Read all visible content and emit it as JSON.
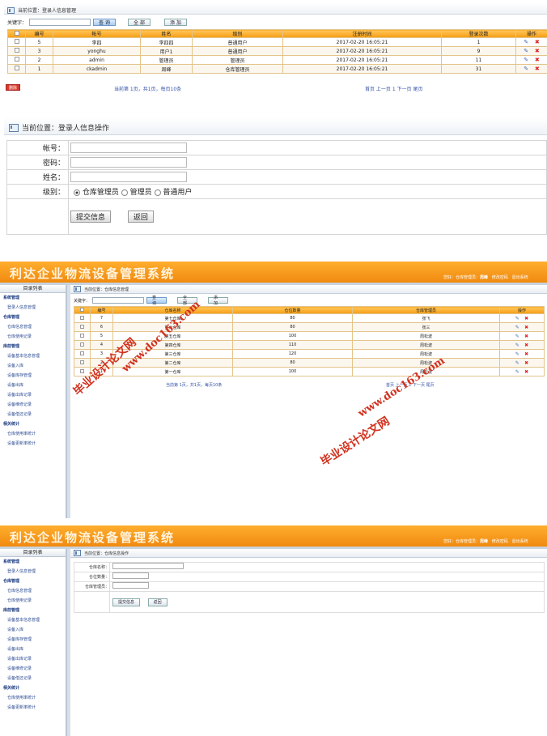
{
  "s1": {
    "crumb": "当前位置：登录人信息管理",
    "kw_label": "关键字：",
    "search_btn": "查 询",
    "all_btn": "全 部",
    "add_btn": "添 加",
    "cols": [
      "编号",
      "帐号",
      "姓名",
      "级别",
      "注册时间",
      "登录次数",
      "操作"
    ],
    "rows": [
      [
        "5",
        "李四",
        "李四四",
        "普通用户",
        "2017-02-20 16:05:21",
        "1"
      ],
      [
        "3",
        "yonghu",
        "用户1",
        "普通用户",
        "2017-02-20 16:05:21",
        "9"
      ],
      [
        "2",
        "admin",
        "管理员",
        "管理员",
        "2017-02-20 16:05:21",
        "11"
      ],
      [
        "1",
        "ckadmin",
        "周峰",
        "仓库管理员",
        "2017-02-20 16:05:21",
        "31"
      ]
    ],
    "delete_btn": "删除",
    "pager_info": "当前第 1页，共1页，每页10条",
    "pager_nav": "首页 上一页 1 下一页 尾页"
  },
  "s2": {
    "crumb": "当前位置：登录人信息操作",
    "labels": [
      "帐号：",
      "密码：",
      "姓名：",
      "级别："
    ],
    "radios": [
      "仓库管理员",
      "管理员",
      "普通用户"
    ],
    "submit": "提交信息",
    "back": "返回"
  },
  "app": {
    "title": "利达企业物流设备管理系统",
    "user_info": "您好：仓库管理员：",
    "user_name": "周峰",
    "change_pwd": "修改密码",
    "logout": "退出系统",
    "menu_title": "目录列表",
    "menu": [
      {
        "group": "系统管理",
        "items": [
          "登录人信息管理"
        ]
      },
      {
        "group": "仓库管理",
        "items": [
          "仓库信息管理",
          "仓库使用记录"
        ]
      },
      {
        "group": "库前管理",
        "items": [
          "设备基本信息管理",
          "设备入库",
          "设备库存管理",
          "设备出库",
          "设备出库记录",
          "设备维修记录",
          "设备借还记录"
        ]
      },
      {
        "group": "相关统计",
        "items": [
          "仓库使用率统计",
          "设备更新率统计"
        ]
      }
    ]
  },
  "s3": {
    "crumb": "当前位置：仓库信息管理",
    "kw_label": "关键字：",
    "search_btn": "查 询",
    "all_btn": "全 部",
    "add_btn": "添 加",
    "cols": [
      "编号",
      "仓库名称",
      "仓位数量",
      "仓库管理员",
      "操作"
    ],
    "rows": [
      [
        "7",
        "第七仓库",
        "80",
        "张飞"
      ],
      [
        "6",
        "第六仓库",
        "80",
        "张三"
      ],
      [
        "5",
        "第五仓库",
        "100",
        "周松波"
      ],
      [
        "4",
        "第四仓库",
        "110",
        "周松波"
      ],
      [
        "3",
        "第三仓库",
        "120",
        "周松波"
      ],
      [
        "2",
        "第二仓库",
        "80",
        "周松波"
      ],
      [
        "1",
        "第一仓库",
        "100",
        "周松波"
      ]
    ],
    "pager_info": "当前第 1页，共1页，每页10条",
    "pager_nav": "首页 上一页 1 下一页 尾页"
  },
  "s4": {
    "crumb": "当前位置：仓库信息操作",
    "labels": [
      "仓库名称：",
      "仓位数量：",
      "仓库管理员："
    ],
    "submit": "提交信息",
    "back": "返回"
  },
  "watermarks": [
    "毕业设计论文网",
    "www.doc163.com"
  ],
  "colors": {
    "orange": "#f59d14",
    "delete_red": "#d63b2c",
    "link_blue": "#3553a8"
  }
}
